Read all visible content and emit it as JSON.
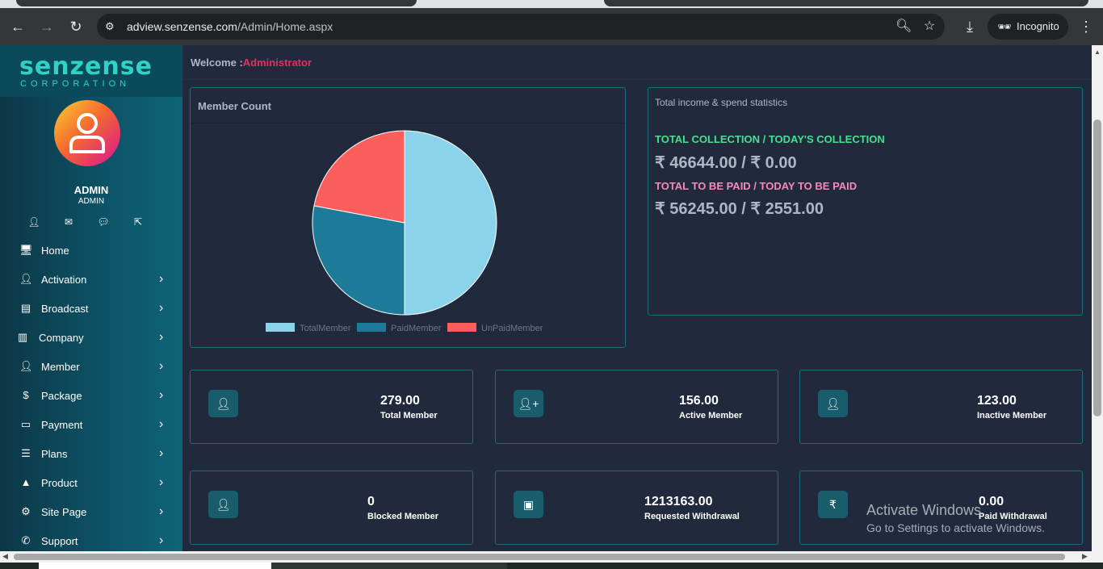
{
  "browser": {
    "url_domain": "adview.senzense.com",
    "url_path": "/Admin/Home.aspx",
    "mode_label": "Incognito"
  },
  "sidebar": {
    "logo_main": "senzense",
    "logo_sub": "CORPORATION",
    "user_name": "ADMIN",
    "user_role": "ADMIN",
    "menu": [
      {
        "label": "Home",
        "icon": "monitor-icon",
        "has_children": false
      },
      {
        "label": "Activation",
        "icon": "user-icon",
        "has_children": true
      },
      {
        "label": "Broadcast",
        "icon": "broadcast-icon",
        "has_children": true
      },
      {
        "label": "Company",
        "icon": "building-icon",
        "has_children": true
      },
      {
        "label": "Member",
        "icon": "user-icon",
        "has_children": true
      },
      {
        "label": "Package",
        "icon": "dollar-icon",
        "has_children": true
      },
      {
        "label": "Payment",
        "icon": "card-icon",
        "has_children": true
      },
      {
        "label": "Plans",
        "icon": "list-icon",
        "has_children": true
      },
      {
        "label": "Product",
        "icon": "product-icon",
        "has_children": true
      },
      {
        "label": "Site Page",
        "icon": "cogs-icon",
        "has_children": true
      },
      {
        "label": "Support",
        "icon": "phone-icon",
        "has_children": true
      }
    ]
  },
  "main": {
    "welcome_label": "Welcome :",
    "welcome_name": "Administrator",
    "member_count_title": "Member Count",
    "stats": {
      "title": "Total income & spend statistics",
      "collection_label": "TOTAL COLLECTION / TODAY'S COLLECTION",
      "collection_value": "₹ 46644.00 / ₹ 0.00",
      "paid_label": "TOTAL TO BE PAID / TODAY TO BE PAID",
      "paid_value": "₹ 56245.00 / ₹ 2551.00"
    },
    "boxes": [
      {
        "value": "279.00",
        "label": "Total Member",
        "icon": "user-icon"
      },
      {
        "value": "156.00",
        "label": "Active Member",
        "icon": "user-plus-icon"
      },
      {
        "value": "123.00",
        "label": "Inactive Member",
        "icon": "user-icon"
      },
      {
        "value": "0",
        "label": "Blocked Member",
        "icon": "user-icon"
      },
      {
        "value": "1213163.00",
        "label": "Requested Withdrawal",
        "icon": "wallet-icon"
      },
      {
        "value": "0.00",
        "label": "Paid Withdrawal",
        "icon": "rupee-icon"
      }
    ]
  },
  "chart_data": {
    "type": "pie",
    "title": "Member Count",
    "categories": [
      "TotalMember",
      "PaidMember",
      "UnPaidMember"
    ],
    "values": [
      279,
      156,
      123
    ],
    "colors": [
      "#8ad3eb",
      "#1d7a99",
      "#fb5f5c"
    ],
    "legend": "bottom"
  },
  "watermark": {
    "line1": "Activate Windows",
    "line2": "Go to Settings to activate Windows."
  }
}
